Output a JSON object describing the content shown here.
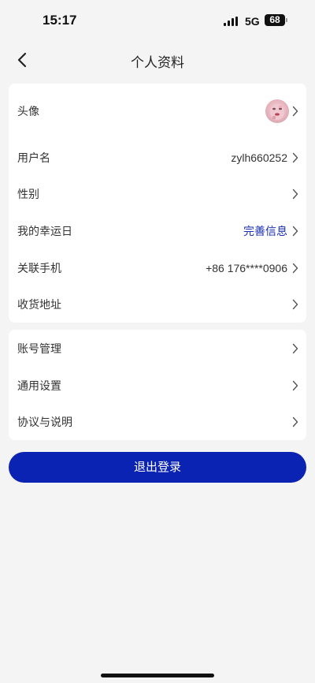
{
  "status": {
    "time": "15:17",
    "network": "5G",
    "battery": "68"
  },
  "nav": {
    "title": "个人资料"
  },
  "profile_rows": [
    {
      "label": "头像",
      "value": "",
      "type": "avatar"
    },
    {
      "label": "用户名",
      "value": "zylh660252"
    },
    {
      "label": "性别",
      "value": ""
    },
    {
      "label": "我的幸运日",
      "value": "完善信息",
      "accent": true
    },
    {
      "label": "关联手机",
      "value": "+86 176****0906"
    },
    {
      "label": "收货地址",
      "value": ""
    }
  ],
  "settings_rows": [
    {
      "label": "账号管理"
    },
    {
      "label": "通用设置"
    },
    {
      "label": "协议与说明"
    }
  ],
  "logout_label": "退出登录",
  "colors": {
    "accent": "#0a23b3",
    "accent_text": "#1a2fae",
    "background": "#f4f4f5"
  }
}
